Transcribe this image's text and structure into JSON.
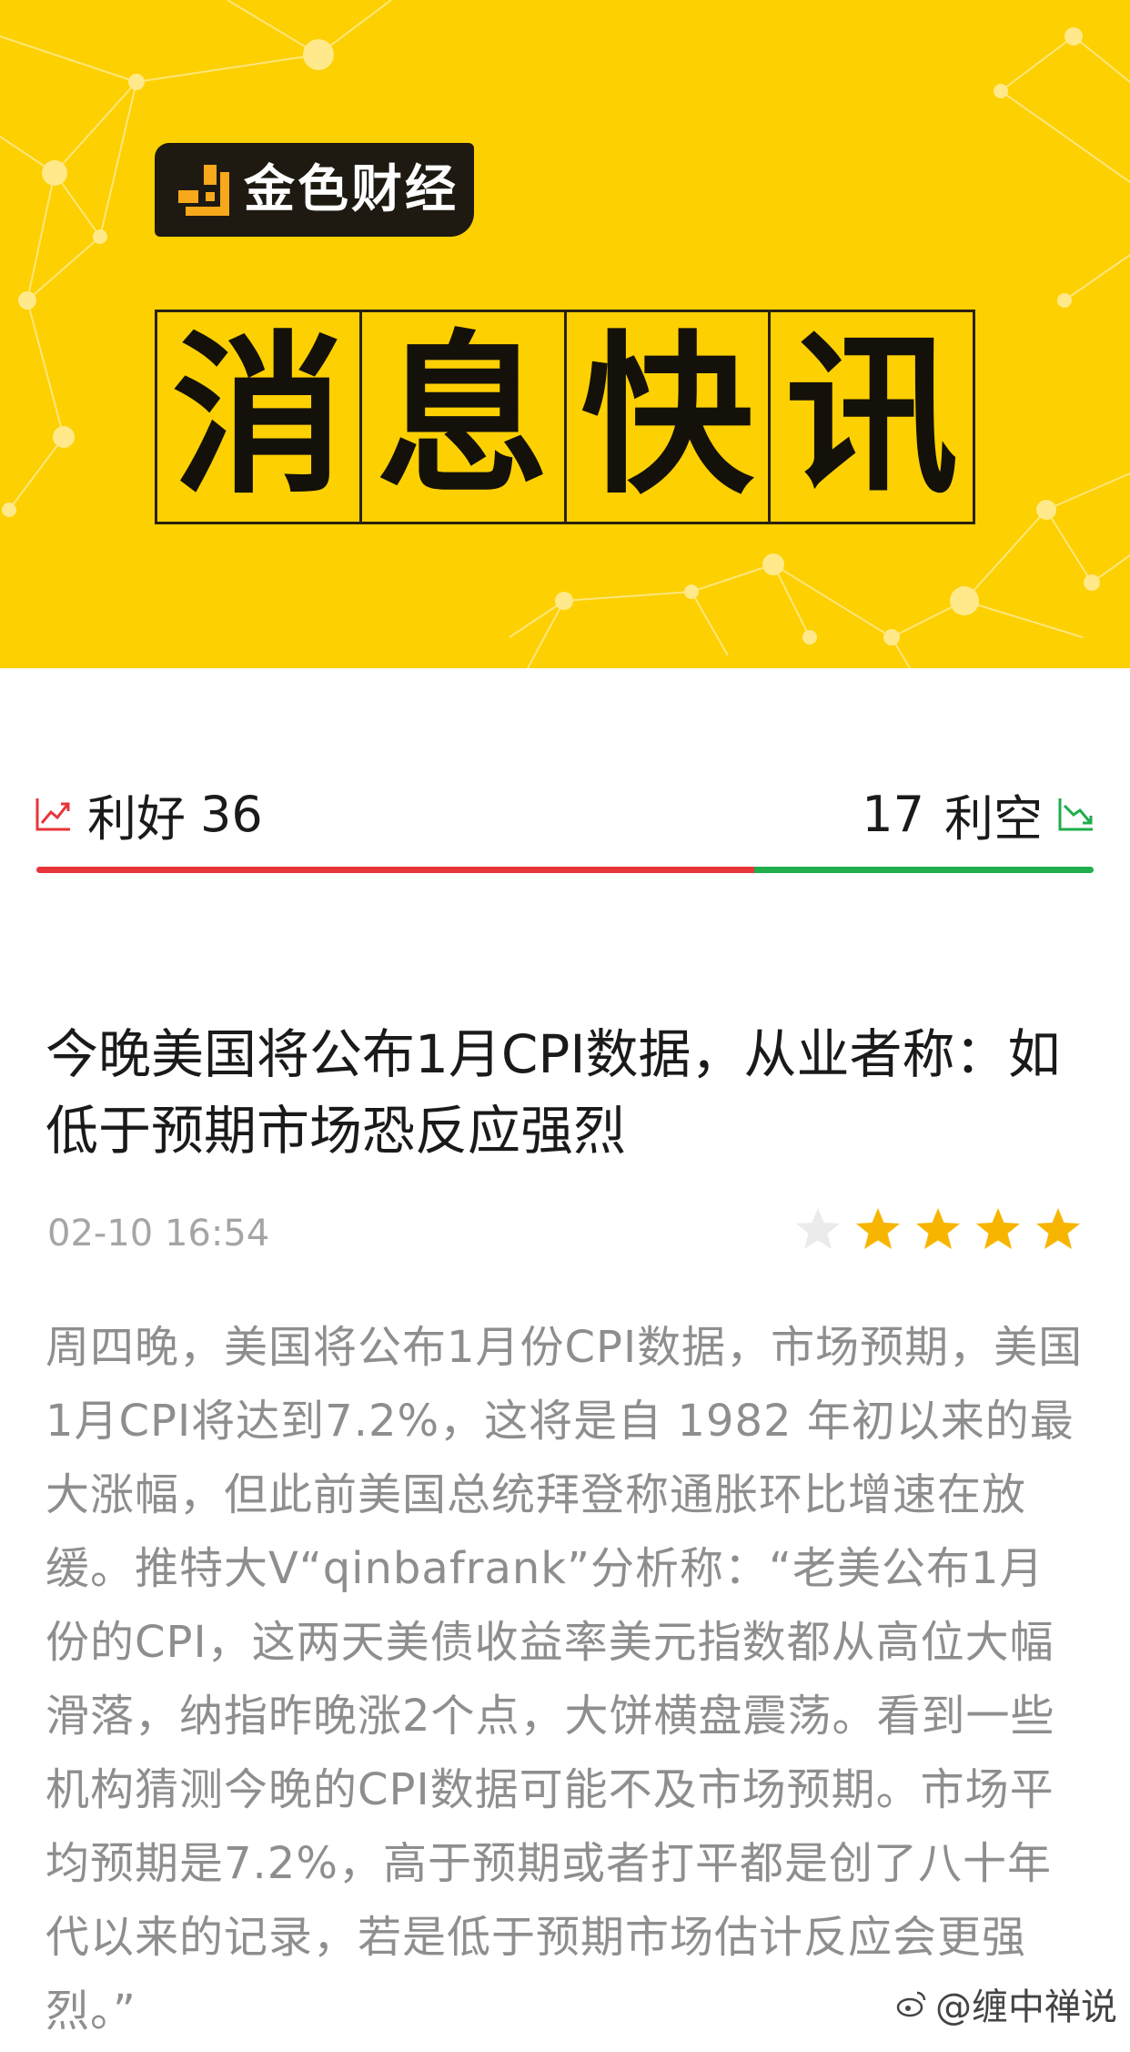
{
  "banner": {
    "logo_text": "金色财经",
    "title_chars": [
      "消",
      "息",
      "快",
      "讯"
    ],
    "bg_color": "#fdd002"
  },
  "sentiment": {
    "bull_label": "利好",
    "bull_count": "36",
    "bear_count": "17",
    "bear_label": "利空",
    "bull_share": 0.6792,
    "bull_color": "#e8353a",
    "bear_color": "#1fae4b"
  },
  "article": {
    "headline": "今晚美国将公布1月CPI数据，从业者称：如低于预期市场恐反应强烈",
    "time": "02-10 16:54",
    "rating": 4,
    "rating_max": 5,
    "body": "周四晚，美国将公布1月份CPI数据，市场预期，美国1月CPI将达到7.2%，这将是自 1982 年初以来的最大涨幅，但此前美国总统拜登称通胀环比增速在放缓。推特大V“qinbafrank”分析称：“老美公布1月份的CPI，这两天美债收益率美元指数都从高位大幅滑落，纳指昨晚涨2个点，大饼横盘震荡。看到一些机构猜测今晚的CPI数据可能不及市场预期。市场平均预期是7.2%，高于预期或者打平都是创了八十年代以来的记录，若是低于预期市场估计反应会更强烈。”"
  },
  "watermark": {
    "text": "@缠中禅说"
  }
}
